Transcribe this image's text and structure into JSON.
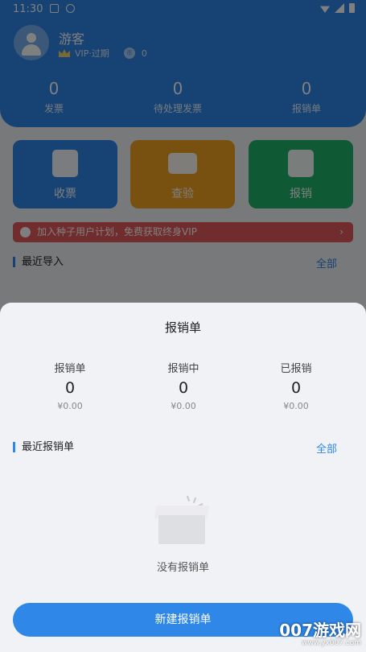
{
  "status_bar": {
    "time": "11:30"
  },
  "profile": {
    "name": "游客",
    "vip": "VIP·过期",
    "coins": "0"
  },
  "stats": [
    {
      "value": "0",
      "label": "发票"
    },
    {
      "value": "0",
      "label": "待处理发票"
    },
    {
      "value": "0",
      "label": "报销单"
    }
  ],
  "tiles": [
    {
      "label": "收票",
      "color": "#2f87e8",
      "icon": "receipt-icon"
    },
    {
      "label": "查验",
      "color": "#f0a020",
      "icon": "ticket-search-icon"
    },
    {
      "label": "报销",
      "color": "#1fb26b",
      "icon": "reimburse-icon"
    }
  ],
  "banner": {
    "text": "加入种子用户计划，免费获取终身VIP",
    "chevron": "›"
  },
  "recent_import": {
    "title": "最近导入",
    "link": "全部"
  },
  "sheet": {
    "title": "报销单",
    "summary": [
      {
        "label": "报销单",
        "count": "0",
        "amount": "¥0.00"
      },
      {
        "label": "报销中",
        "count": "0",
        "amount": "¥0.00"
      },
      {
        "label": "已报销",
        "count": "0",
        "amount": "¥0.00"
      }
    ],
    "recent": {
      "title": "最近报销单",
      "link": "全部"
    },
    "empty_text": "没有报销单",
    "new_button": "新建报销单"
  },
  "watermark": {
    "brand": "007游戏网",
    "url": "www.yx007.com"
  }
}
